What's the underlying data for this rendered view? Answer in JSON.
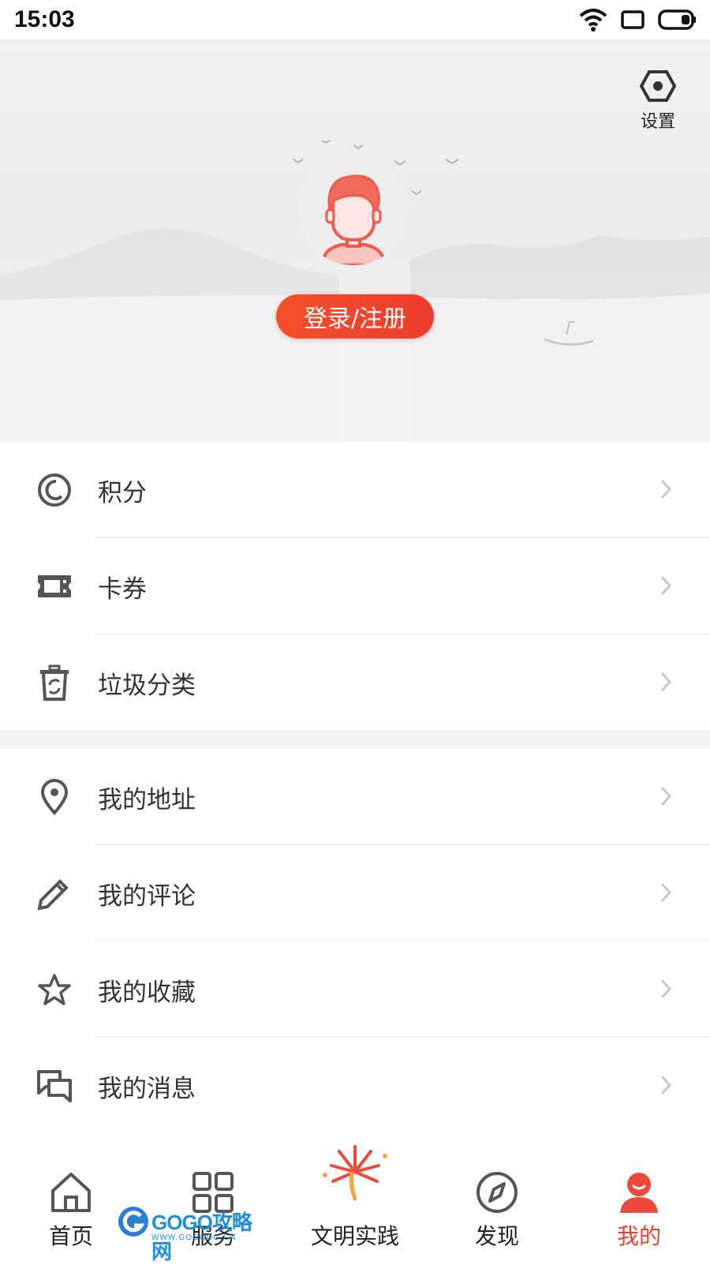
{
  "status_bar": {
    "time": "15:03"
  },
  "header": {
    "settings_label": "设置",
    "login_label": "登录/注册"
  },
  "menu_group_1": [
    {
      "label": "积分",
      "icon": "points-icon"
    },
    {
      "label": "卡券",
      "icon": "coupon-icon"
    },
    {
      "label": "垃圾分类",
      "icon": "recycle-bin-icon"
    }
  ],
  "menu_group_2": [
    {
      "label": "我的地址",
      "icon": "location-pin-icon"
    },
    {
      "label": "我的评论",
      "icon": "pencil-icon"
    },
    {
      "label": "我的收藏",
      "icon": "star-icon"
    },
    {
      "label": "我的消息",
      "icon": "chat-bubbles-icon"
    }
  ],
  "tab_bar": [
    {
      "label": "首页",
      "icon": "home-icon"
    },
    {
      "label": "服务",
      "icon": "grid-icon"
    },
    {
      "label": "文明实践",
      "icon": "firework-icon"
    },
    {
      "label": "发现",
      "icon": "compass-icon"
    },
    {
      "label": "我的",
      "icon": "person-icon",
      "active": true
    }
  ],
  "watermark": {
    "text": "GOGO攻略网",
    "subtext": "WWW.GOGOGO.CN"
  },
  "colors": {
    "accent": "#e8412c",
    "icon_gray": "#555555",
    "chevron": "#c8c8c8"
  }
}
